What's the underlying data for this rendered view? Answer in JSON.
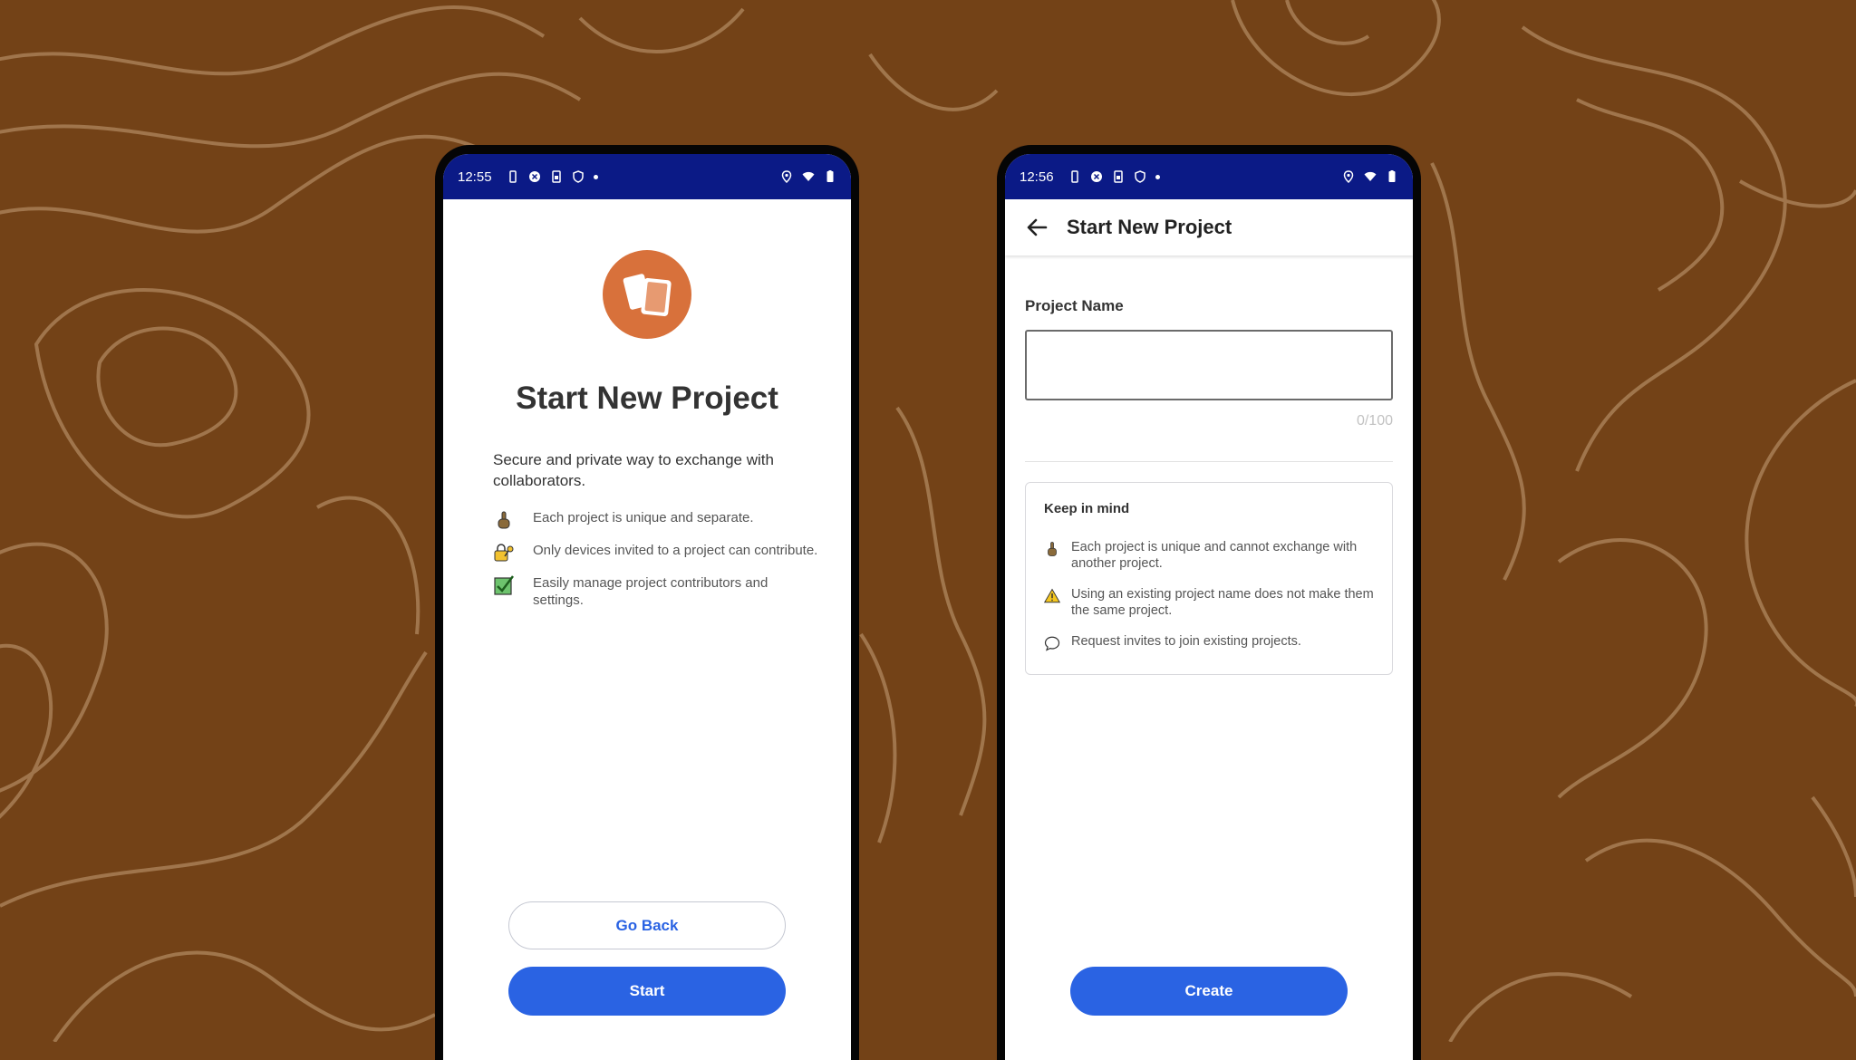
{
  "colors": {
    "background": "#734217",
    "contour_lines": "#a87f56",
    "status_bar": "#0b1a86",
    "accent_blue": "#2a63e3",
    "logo_orange": "#d8713b"
  },
  "screen1": {
    "status": {
      "time": "12:55"
    },
    "title": "Start New Project",
    "description": "Secure and private way to exchange with collaborators.",
    "features": [
      {
        "icon": "pointing-finger-icon",
        "text": "Each project is unique and separate."
      },
      {
        "icon": "lock-key-icon",
        "text": "Only devices invited to a project can contribute."
      },
      {
        "icon": "checkbox-icon",
        "text": "Easily manage project contributors and settings."
      }
    ],
    "go_back_label": "Go Back",
    "start_label": "Start"
  },
  "screen2": {
    "status": {
      "time": "12:56"
    },
    "app_bar_title": "Start New Project",
    "field_label": "Project Name",
    "field_value": "",
    "counter": "0/100",
    "keep_in_mind": {
      "title": "Keep in mind",
      "items": [
        {
          "icon": "pointing-finger-icon",
          "text": "Each project is unique and cannot exchange with another project."
        },
        {
          "icon": "warning-icon",
          "text": "Using an existing project name does not make them the same project."
        },
        {
          "icon": "chat-bubble-icon",
          "text": "Request invites to join existing projects."
        }
      ]
    },
    "create_label": "Create"
  }
}
